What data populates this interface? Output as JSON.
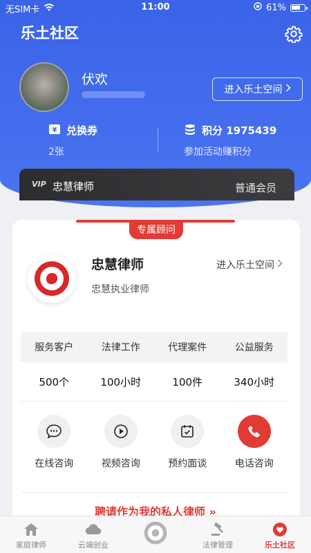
{
  "status": {
    "carrier": "无SIM卡",
    "time": "11:00",
    "battery": "61%"
  },
  "header": {
    "title": "乐土社区"
  },
  "user": {
    "name": "伏欢",
    "enter_space": "进入乐土空间"
  },
  "stats": {
    "voucher": {
      "label": "兑换券",
      "value": "2张"
    },
    "points": {
      "label": "积分 1975439",
      "sub": "参加活动赚积分"
    }
  },
  "vip": {
    "badge": "VIP",
    "name": "忠慧律师",
    "level": "普通会员"
  },
  "advisor": {
    "tag": "专属顾问",
    "name": "忠慧律师",
    "title": "忠慧执业律师",
    "enter_space": "进入乐土空间"
  },
  "service_table": {
    "headers": [
      "服务客户",
      "法律工作",
      "代理案件",
      "公益服务"
    ],
    "values": [
      "500个",
      "100小时",
      "100件",
      "340小时"
    ]
  },
  "actions": [
    {
      "label": "在线咨询",
      "icon": "chat-icon"
    },
    {
      "label": "视频咨询",
      "icon": "play-icon"
    },
    {
      "label": "预约面谈",
      "icon": "calendar-check-icon"
    },
    {
      "label": "电话咨询",
      "icon": "phone-icon"
    }
  ],
  "hire": {
    "label": "聘请作为我的私人律师 »"
  },
  "tabs": [
    {
      "label": "家庭律师",
      "icon": "home-icon"
    },
    {
      "label": "云端创业",
      "icon": "cloud-icon"
    },
    {
      "label": "",
      "icon": "brand-logo-icon"
    },
    {
      "label": "法律管理",
      "icon": "gavel-icon"
    },
    {
      "label": "乐土社区",
      "icon": "community-heart-icon",
      "active": true
    }
  ],
  "colors": {
    "primary": "#3a63e8",
    "accent": "#e23b36",
    "vip_bg": "#2d2d30"
  }
}
